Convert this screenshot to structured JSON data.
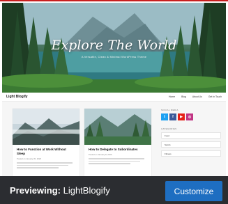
{
  "hero": {
    "title": "Explore The World",
    "subtitle": "A Versatile, Clean & Minimal WordPress Theme"
  },
  "nav": {
    "brand": "Light Blogify",
    "menu": [
      "Home",
      "Blog",
      "About Us",
      "Get In Touch"
    ]
  },
  "posts": [
    {
      "title": "How to Function at Work Without Sleep",
      "meta": "Posted on January 20, 2020"
    },
    {
      "title": "How to Delegate to Subordinates",
      "meta": "Posted on January 8, 2020"
    }
  ],
  "sidebar": {
    "social_heading": "SOCIAL MEDIA",
    "social_icons": [
      {
        "icon": "twitter-icon",
        "glyph": "t",
        "color": "#1da1f2"
      },
      {
        "icon": "facebook-icon",
        "glyph": "f",
        "color": "#3b5998"
      },
      {
        "icon": "youtube-icon",
        "glyph": "▶",
        "color": "#e62117"
      },
      {
        "icon": "instagram-icon",
        "glyph": "◎",
        "color": "#c13584"
      }
    ],
    "categories_heading": "CATEGORIES",
    "categories": [
      "Food",
      "Sports",
      "Fitness"
    ]
  },
  "preview": {
    "label": "Previewing:",
    "theme_name": "LightBlogify",
    "customize_label": "Customize"
  },
  "colors": {
    "preview_bar": "#2b2d31",
    "customize_button": "#1e6ec1",
    "frame_border": "#c81e1e"
  }
}
